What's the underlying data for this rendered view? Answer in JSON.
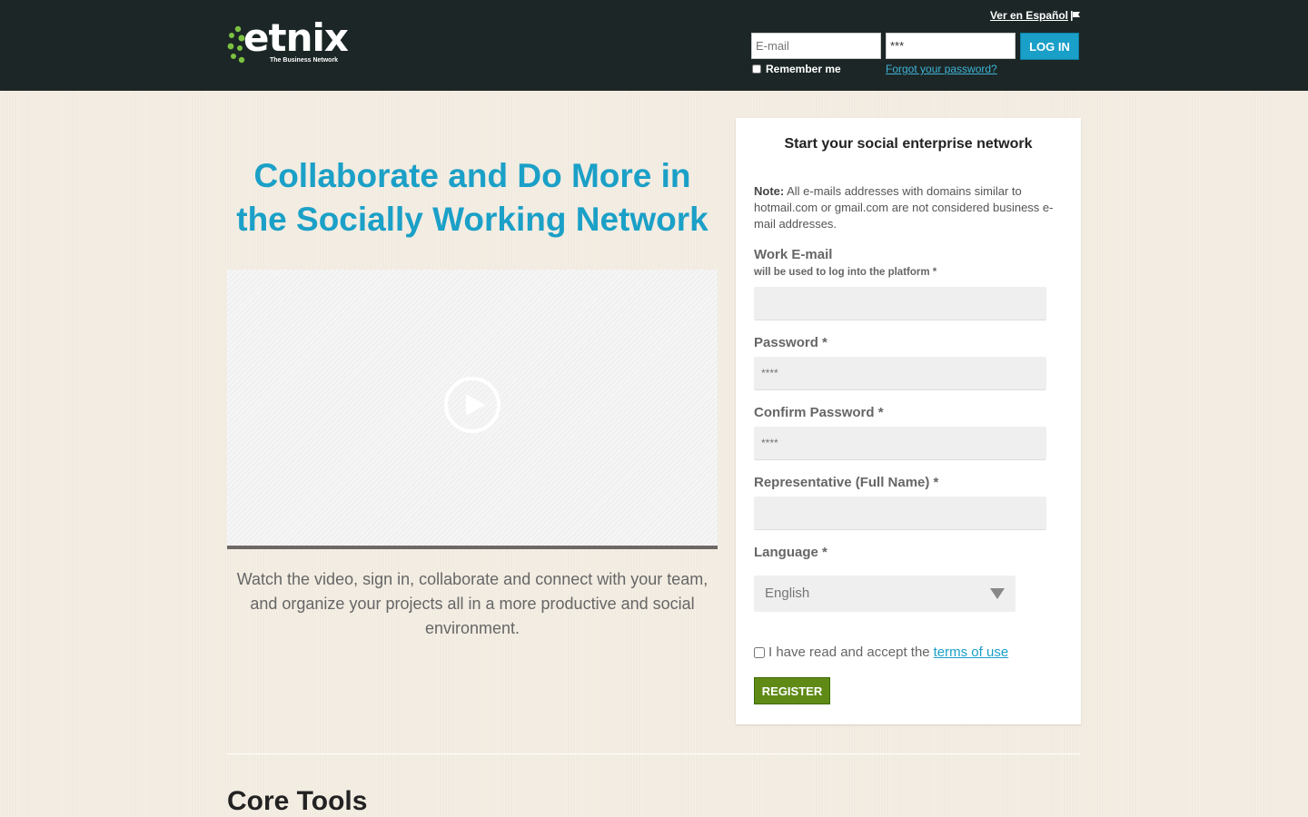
{
  "header": {
    "logo_text": "etnix",
    "logo_tagline": "The Business Network",
    "language_link": "Ver en Español",
    "login": {
      "email_placeholder": "E-mail",
      "password_value": "***",
      "login_label": "LOG IN",
      "remember_label": "Remember me",
      "forgot_label": "Forgot your password?"
    }
  },
  "hero": {
    "headline": "Collaborate and Do More in the Socially Working Network",
    "video_description": "Watch the video, sign in, collaborate and connect with your team, and organize your projects all in a more productive and social environment."
  },
  "register": {
    "title": "Start your social enterprise network",
    "note_label": "Note:",
    "note_text": "All e-mails addresses with domains similar to hotmail.com or gmail.com are not considered business e-mail addresses.",
    "work_email_label": "Work E-mail",
    "work_email_sub": "will be used to log into the platform",
    "required_mark": "*",
    "password_label": "Password *",
    "password_placeholder": "****",
    "confirm_label": "Confirm Password *",
    "confirm_placeholder": "****",
    "name_label": "Representative (Full Name) *",
    "language_label": "Language *",
    "language_value": "English",
    "terms_text": "I have read and accept the",
    "terms_link": "terms of use",
    "register_label": "REGISTER"
  },
  "core_tools_title": "Core Tools",
  "colors": {
    "header_bg": "#1c2626",
    "accent": "#1a9fc8",
    "register_green": "#5f8a16",
    "logo_green": "#7cc242"
  },
  "icons": [
    "flag-icon",
    "play-icon",
    "chevron-down-icon"
  ]
}
